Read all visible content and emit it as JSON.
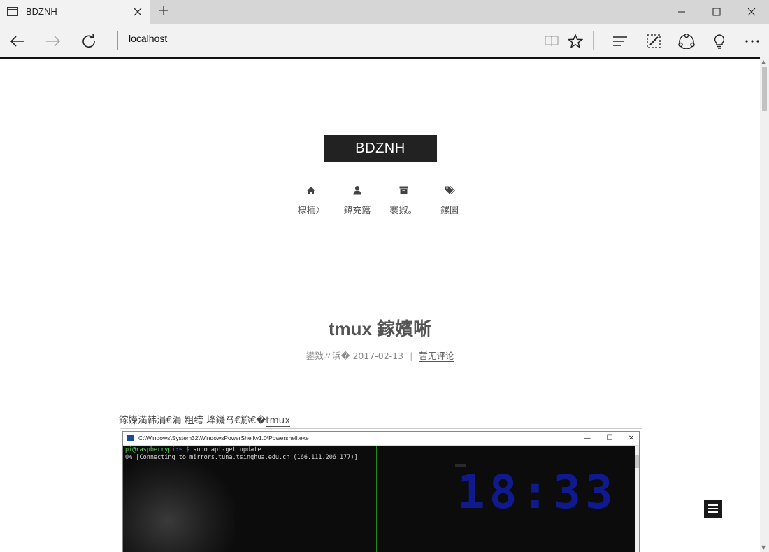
{
  "browser": {
    "tab_title": "BDZNH",
    "address": "localhost",
    "icons": {
      "tab_page": "tab-page-icon",
      "close_tab": "close-icon",
      "new_tab": "plus-icon",
      "back": "back-arrow-icon",
      "forward": "forward-arrow-icon",
      "refresh": "refresh-icon",
      "reading_view": "book-icon",
      "favorite": "star-icon",
      "hub": "hub-icon",
      "web_note": "pen-note-icon",
      "share": "share-icon",
      "feedback": "lightbulb-icon",
      "more": "more-icon"
    }
  },
  "site": {
    "logo": "BDZNH",
    "menu": [
      {
        "label": "棣栭〉",
        "icon": "home-icon"
      },
      {
        "label": "鍏充簬",
        "icon": "user-icon"
      },
      {
        "label": "褰掓。",
        "icon": "archive-icon"
      },
      {
        "label": "鏍囩",
        "icon": "tags-icon"
      }
    ]
  },
  "post": {
    "title": "tmux 鎵嬪唽",
    "meta_date": "鍙戣〃浜� 2017-02-13",
    "meta_sep": "|",
    "meta_comments": "暂无评论",
    "intro_text": "鎵嬫満韩涓€涓   粗绔   埄鐖ㄢ€旀€�",
    "intro_link": "tmux"
  },
  "screenshot": {
    "window_title": "C:\\Windows\\System32\\WindowsPowerShell\\v1.0\\Powershell.exe",
    "prompt_user": "pi@raspberrypi",
    "prompt_path": ":~ $",
    "command": " sudo apt-get update",
    "output": "0% [Connecting to mirrors.tuna.tsinghua.edu.cn (166.111.206.177)]",
    "clock": "18:33"
  },
  "colors": {
    "logo_bg": "#222222",
    "clock": "#101a8c",
    "prompt_user": "#5fd75f",
    "prompt_path": "#5f87ff"
  }
}
